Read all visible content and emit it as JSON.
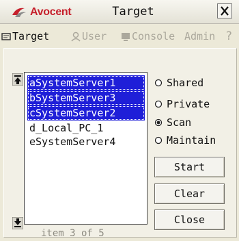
{
  "window": {
    "brand": "Avocent",
    "title": "Target",
    "close_label": "X"
  },
  "tabs": [
    {
      "label": "Target",
      "active": true,
      "icon": "target-icon"
    },
    {
      "label": "User",
      "active": false,
      "icon": "user-icon"
    },
    {
      "label": "Console",
      "active": false,
      "icon": "console-icon"
    },
    {
      "label": "Admin",
      "active": false,
      "icon": null
    },
    {
      "label": "?",
      "active": false,
      "icon": null
    }
  ],
  "target_list": {
    "items": [
      {
        "label": "aSystemServer1",
        "selected": true
      },
      {
        "label": "bSystemServer3",
        "selected": true
      },
      {
        "label": "cSystemServer2",
        "selected": true
      },
      {
        "label": "d_Local_PC_1",
        "selected": false
      },
      {
        "label": "eSystemServer4",
        "selected": false
      }
    ],
    "status": "item 3 of 5"
  },
  "modes": {
    "options": [
      "Shared",
      "Private",
      "Scan",
      "Maintain"
    ],
    "selected": "Scan"
  },
  "buttons": {
    "start": "Start",
    "clear": "Clear",
    "close": "Close"
  },
  "colors": {
    "brand_red": "#c6202c",
    "selection_blue": "#1f1fd8",
    "window_bg": "#ece9d8"
  }
}
